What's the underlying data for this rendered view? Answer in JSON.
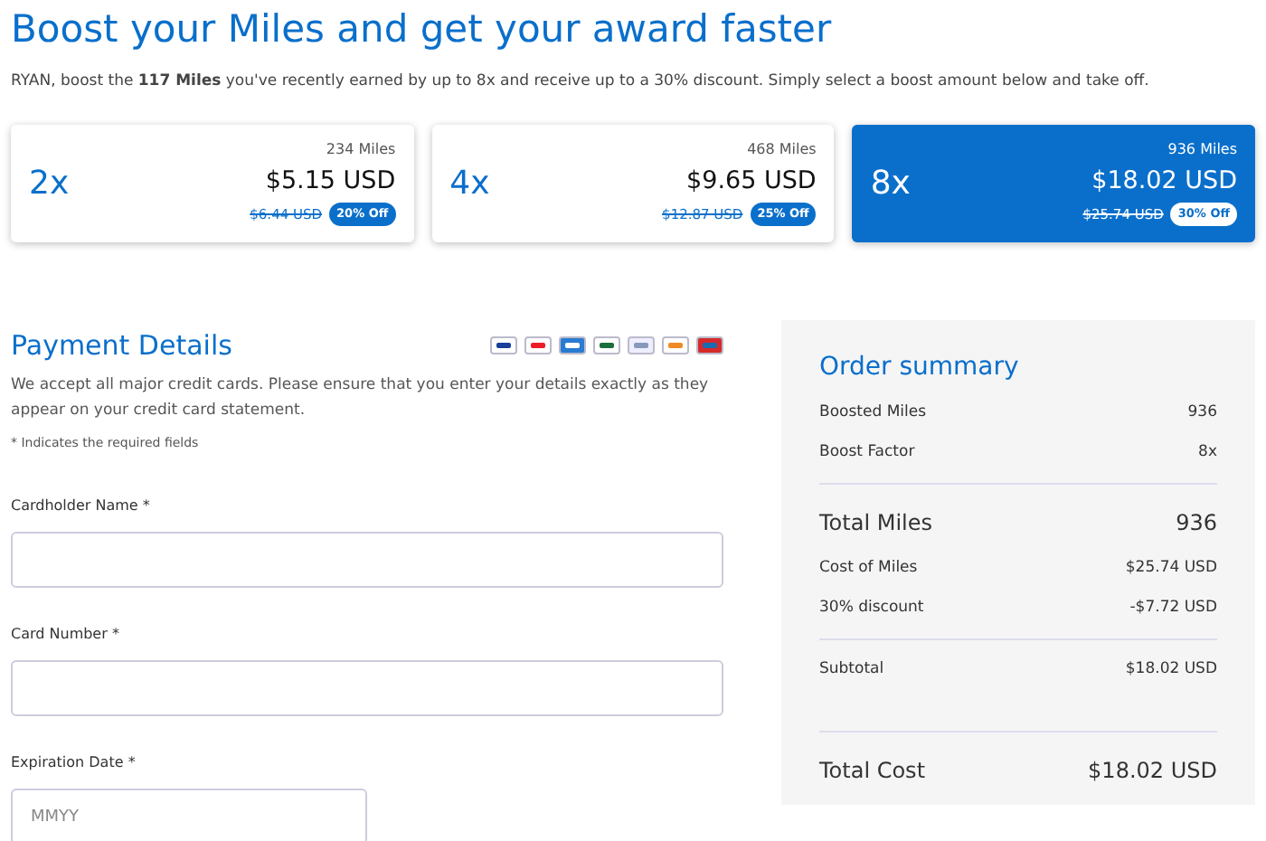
{
  "title": "Boost your Miles and get your award faster",
  "intro": "RYAN, boost the **117 Miles** you've recently earned by up to 8x and receive up to a 30% discount. Simply select a boost amount below and take off.",
  "boosts": [
    {
      "factor": "2x",
      "miles": "234 Miles",
      "price": "$5.15 USD",
      "old_price": "$6.44 USD",
      "discount": "20% Off",
      "selected": false
    },
    {
      "factor": "4x",
      "miles": "468 Miles",
      "price": "$9.65 USD",
      "old_price": "$12.87 USD",
      "discount": "25% Off",
      "selected": false
    },
    {
      "factor": "8x",
      "miles": "936 Miles",
      "price": "$18.02 USD",
      "old_price": "$25.74 USD",
      "discount": "30% Off",
      "selected": true
    }
  ],
  "payment": {
    "heading": "Payment Details",
    "note": "We accept all major credit cards. Please ensure that you enter your details exactly as they appear on your credit card statement.",
    "required_note": "* Indicates the required fields",
    "fields": [
      {
        "label": "Cardholder Name *",
        "kind": "wide"
      },
      {
        "label": "Card Number *",
        "kind": "wide"
      },
      {
        "label": "Expiration Date *",
        "kind": "narrow",
        "placeholder": "MMYY"
      }
    ]
  },
  "summary": {
    "heading": "Order summary",
    "rows": [
      {
        "label": "Boosted Miles",
        "value": "936",
        "kind": "small",
        "divider_above": false
      },
      {
        "label": "Boost Factor",
        "value": "8x",
        "kind": "small",
        "divider_above": false
      },
      {
        "label": "Total Miles",
        "value": "936",
        "kind": "large",
        "divider_above": true
      },
      {
        "label": "Cost of Miles",
        "value": "$25.74 USD",
        "kind": "small",
        "divider_above": false
      },
      {
        "label": "30% discount",
        "value": "-$7.72 USD",
        "kind": "small",
        "divider_above": false
      },
      {
        "label": "Subtotal",
        "value": "$18.02 USD",
        "kind": "small",
        "divider_above": true
      },
      {
        "label": "Total Cost",
        "value": "$18.02 USD",
        "kind": "large",
        "divider_above": true
      }
    ]
  }
}
